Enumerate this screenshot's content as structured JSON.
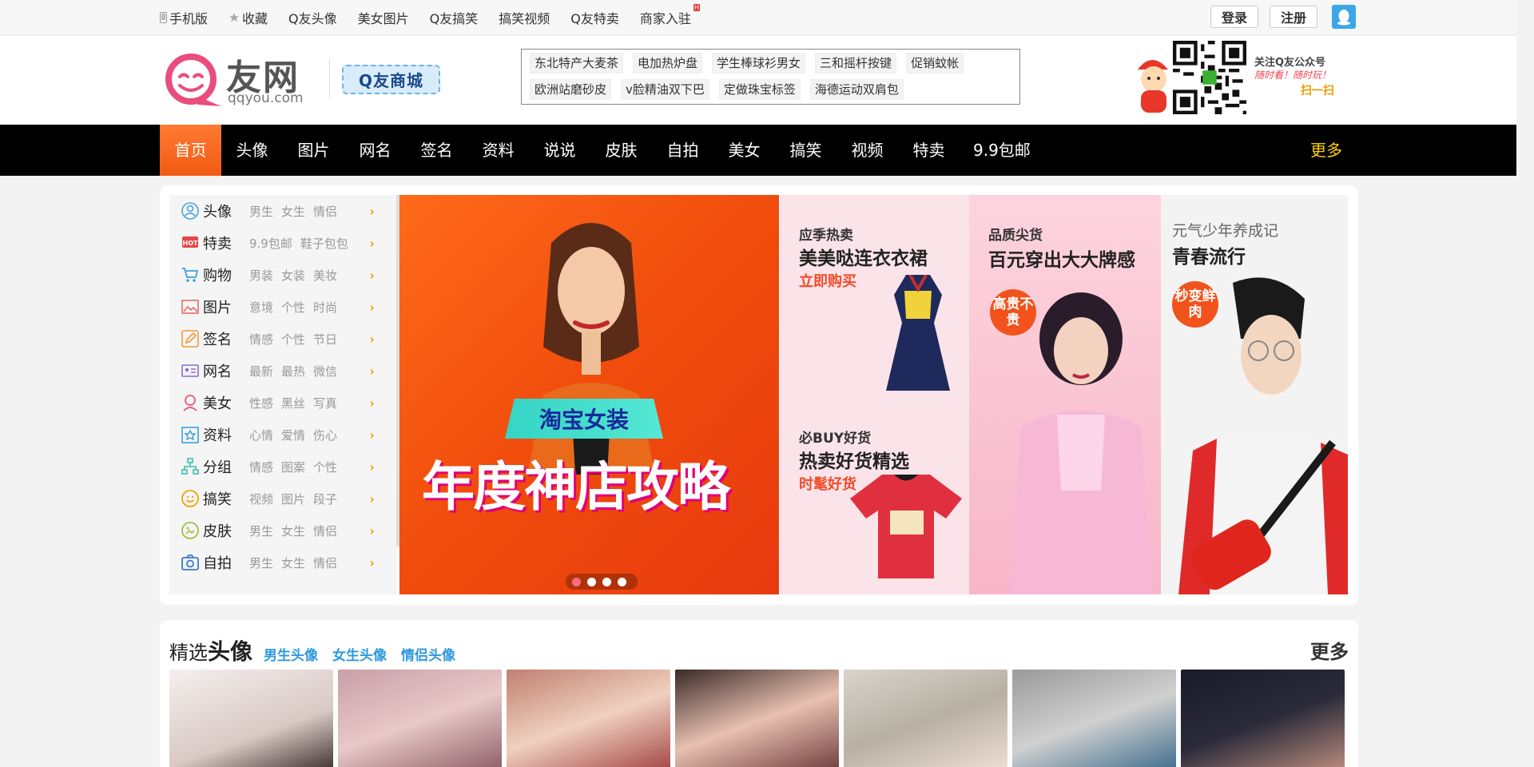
{
  "topbar": {
    "links": [
      {
        "label": "手机版",
        "icon": "phone-icon"
      },
      {
        "label": "收藏",
        "icon": "star-icon"
      },
      {
        "label": "Q友头像"
      },
      {
        "label": "美女图片"
      },
      {
        "label": "Q友搞笑"
      },
      {
        "label": "搞笑视频"
      },
      {
        "label": "Q友特卖"
      },
      {
        "label": "商家入驻",
        "badge": "H"
      }
    ],
    "login": "登录",
    "register": "注册"
  },
  "header": {
    "logo_text": "友网",
    "logo_sub": "qqyou.com",
    "mall_label": "Q友商城",
    "hot_tags": [
      "东北特产大麦茶",
      "电加热炉盘",
      "学生棒球衫男女",
      "三和摇杆按键",
      "促销蚊帐",
      "欧洲站磨砂皮",
      "v脸精油双下巴",
      "定做珠宝标签",
      "海德运动双肩包"
    ],
    "qr_title": "关注Q友公众号",
    "qr_sub": "随时看！随时玩！",
    "qr_scan": "扫一扫"
  },
  "nav": {
    "items": [
      "首页",
      "头像",
      "图片",
      "网名",
      "签名",
      "资料",
      "说说",
      "皮肤",
      "自拍",
      "美女",
      "搞笑",
      "视频",
      "特卖",
      "9.9包邮"
    ],
    "active_index": 0,
    "more": "更多"
  },
  "categories": [
    {
      "name": "头像",
      "icon": "user-icon",
      "color": "#4aa3e8",
      "subs": [
        "男生",
        "女生",
        "情侣"
      ]
    },
    {
      "name": "特卖",
      "icon": "hot-icon",
      "color": "#e84545",
      "subs": [
        "9.9包邮",
        "鞋子包包"
      ]
    },
    {
      "name": "购物",
      "icon": "cart-icon",
      "color": "#3aa0e0",
      "subs": [
        "男装",
        "女装",
        "美妆"
      ]
    },
    {
      "name": "图片",
      "icon": "image-icon",
      "color": "#e86a6a",
      "subs": [
        "意境",
        "个性",
        "时尚"
      ]
    },
    {
      "name": "签名",
      "icon": "pen-icon",
      "color": "#f09a3a",
      "subs": [
        "情感",
        "个性",
        "节日"
      ]
    },
    {
      "name": "网名",
      "icon": "id-card-icon",
      "color": "#8a6ad8",
      "subs": [
        "最新",
        "最热",
        "微信"
      ]
    },
    {
      "name": "美女",
      "icon": "woman-icon",
      "color": "#e85a7a",
      "subs": [
        "性感",
        "黑丝",
        "写真"
      ]
    },
    {
      "name": "资料",
      "icon": "star-box-icon",
      "color": "#3aa0e0",
      "subs": [
        "心情",
        "爱情",
        "伤心"
      ]
    },
    {
      "name": "分组",
      "icon": "org-tree-icon",
      "color": "#3ac0b0",
      "subs": [
        "情感",
        "图案",
        "个性"
      ]
    },
    {
      "name": "搞笑",
      "icon": "smile-icon",
      "color": "#f0a500",
      "subs": [
        "视频",
        "图片",
        "段子"
      ]
    },
    {
      "name": "皮肤",
      "icon": "palette-icon",
      "color": "#a0c040",
      "subs": [
        "男生",
        "女生",
        "情侣"
      ]
    },
    {
      "name": "自拍",
      "icon": "camera-icon",
      "color": "#3a7ad0",
      "subs": [
        "男生",
        "女生",
        "情侣"
      ]
    }
  ],
  "banner": {
    "tag": "淘宝女装",
    "headline": "年度神店攻略",
    "slides": 4,
    "active_slide": 0
  },
  "promos": {
    "p1": {
      "top_label": "应季热卖",
      "top_title": "美美哒连衣衣裙",
      "top_link": "立即购买",
      "bottom_label": "必BUY好货",
      "bottom_title": "热卖好货精选",
      "bottom_link": "时髦好货"
    },
    "p2": {
      "label": "品质尖货",
      "title": "百元穿出大大牌感",
      "badge": "高贵不贵"
    },
    "p3": {
      "label": "元气少年养成记",
      "title": "青春流行",
      "badge": "秒变鲜肉"
    }
  },
  "avatars": {
    "title_prefix": "精选",
    "title_main": "头像",
    "tabs": [
      "男生头像",
      "女生头像",
      "情侣头像"
    ],
    "more": "更多"
  },
  "colors": {
    "accent": "#f15a12",
    "nav_bg": "#000000",
    "link_blue": "#2c98de",
    "more_yellow": "#ffd200"
  }
}
